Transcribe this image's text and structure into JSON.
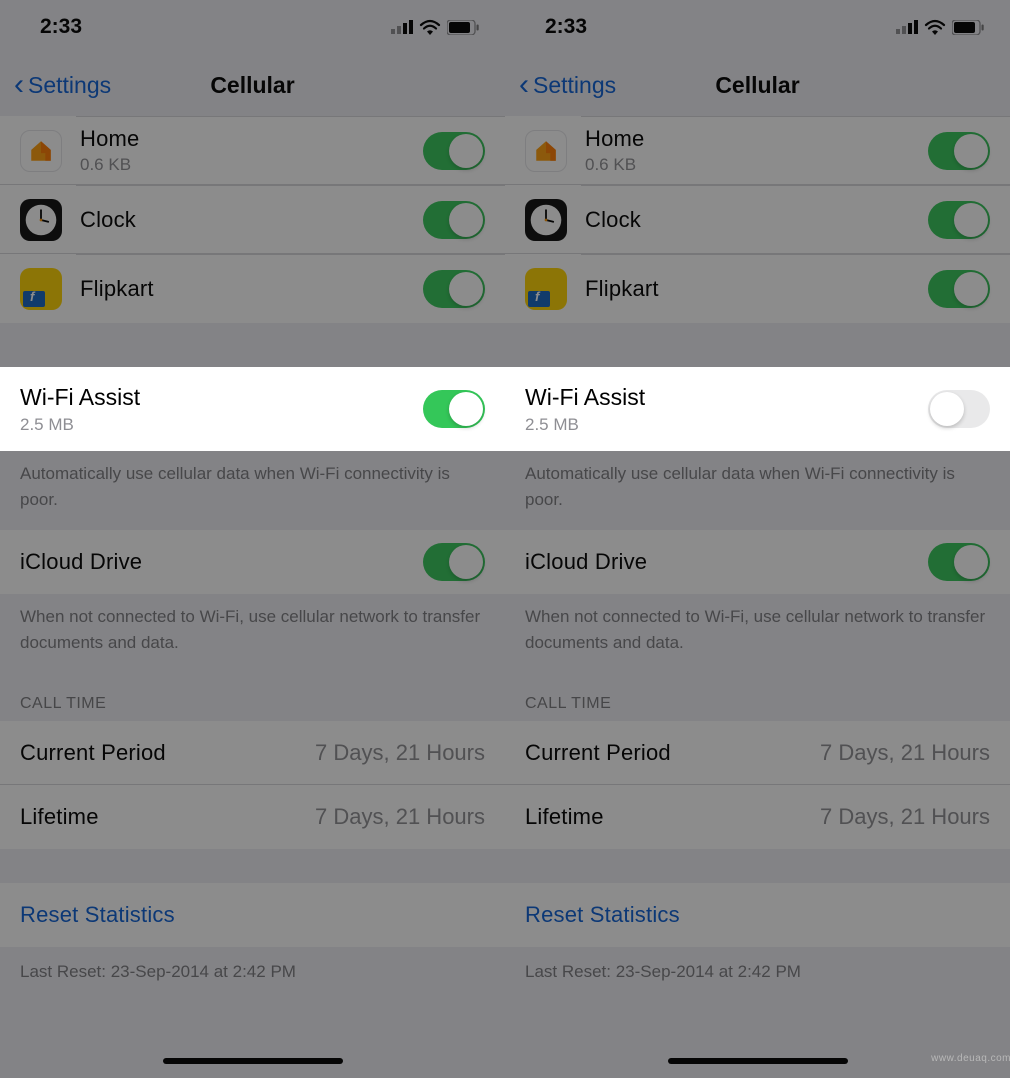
{
  "status": {
    "time": "2:33"
  },
  "nav": {
    "back": "Settings",
    "title": "Cellular"
  },
  "apps": [
    {
      "name": "Home",
      "sub": "0.6 KB",
      "icon": "home-icon",
      "on": true
    },
    {
      "name": "Clock",
      "sub": "",
      "icon": "clock-icon",
      "on": true
    },
    {
      "name": "Flipkart",
      "sub": "",
      "icon": "flipkart-icon",
      "on": true
    }
  ],
  "wifi_assist": {
    "label": "Wi-Fi Assist",
    "sub": "2.5 MB"
  },
  "wifi_assist_footer": "Automatically use cellular data when Wi-Fi connectivity is poor.",
  "icloud": {
    "label": "iCloud Drive",
    "on": true
  },
  "icloud_footer": "When not connected to Wi-Fi, use cellular network to transfer documents and data.",
  "call_time_header": "CALL TIME",
  "current_period": {
    "label": "Current Period",
    "value": "7 Days, 21 Hours"
  },
  "lifetime": {
    "label": "Lifetime",
    "value": "7 Days, 21 Hours"
  },
  "reset": "Reset Statistics",
  "last_reset": "Last Reset: 23-Sep-2014 at 2:42 PM",
  "panes": [
    {
      "wifi_assist_on": true
    },
    {
      "wifi_assist_on": false
    }
  ],
  "watermark": "www.deuaq.com"
}
